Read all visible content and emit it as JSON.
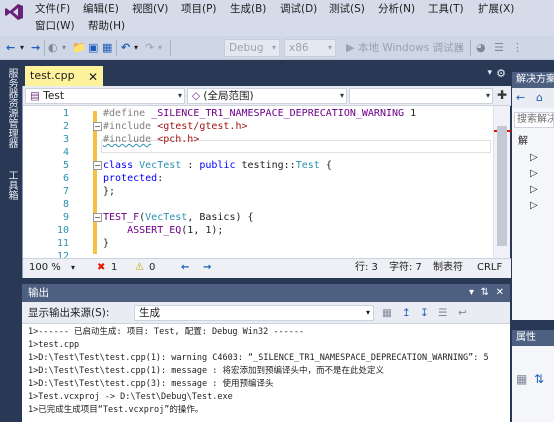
{
  "menu": {
    "row1": [
      "文件(F)",
      "编辑(E)",
      "视图(V)",
      "项目(P)",
      "生成(B)",
      "调试(D)",
      "测试(S)",
      "分析(N)",
      "工具(T)",
      "扩展(X)"
    ],
    "row2": [
      "窗口(W)",
      "帮助(H)"
    ]
  },
  "toolbar": {
    "config": "Debug",
    "platform": "x86",
    "run_label": "本地 Windows 调试器"
  },
  "left_strip": {
    "server_explorer": "服务器资源管理器",
    "toolbox": "工具箱"
  },
  "tab": {
    "filename": "test.cpp"
  },
  "nav": {
    "project": "Test",
    "scope": "(全局范围)"
  },
  "editor": {
    "lines": [
      "1",
      "2",
      "3",
      "4",
      "5",
      "6",
      "7",
      "8",
      "9",
      "10",
      "11",
      "12"
    ]
  },
  "status": {
    "zoom": "100 %",
    "errors": "1",
    "warnings": "0",
    "line": "行: 3",
    "col": "字符: 7",
    "tabs": "制表符",
    "eol": "CRLF"
  },
  "output": {
    "title": "输出",
    "source_label": "显示输出来源(S):",
    "source_value": "生成",
    "lines": [
      "1>------ 已启动生成: 项目: Test, 配置: Debug Win32 ------",
      "1>test.cpp",
      "1>D:\\Test\\Test\\test.cpp(1): warning C4603: “_SILENCE_TR1_NAMESPACE_DEPRECATION_WARNING”: 5",
      "1>D:\\Test\\Test\\test.cpp(1): message : 将宏添加到预编译头中，而不是在此处定义",
      "1>D:\\Test\\Test\\test.cpp(3): message : 使用预编译头",
      "1>Test.vcxproj -> D:\\Test\\Debug\\Test.exe",
      "1>已完成生成项目“Test.vcxproj”的操作。"
    ]
  },
  "solution_explorer": {
    "title": "解决方案",
    "search": "搜索解决",
    "nodes": [
      "解",
      "▷",
      "▷",
      "▷",
      "▷"
    ]
  },
  "properties": {
    "title": "属性"
  },
  "colors": {
    "accent_tab": "#fff29d",
    "chrome": "#293955",
    "panel_header": "#4d6082"
  }
}
